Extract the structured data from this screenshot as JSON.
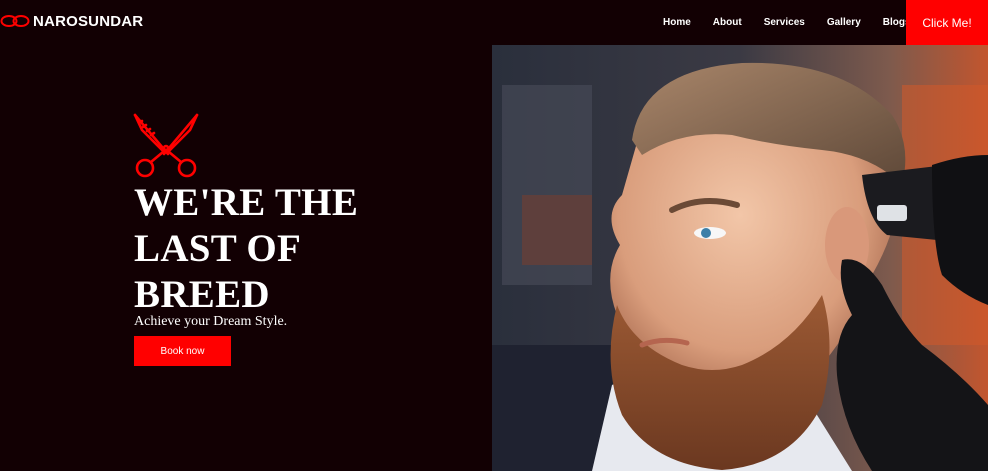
{
  "brand": {
    "name": "NAROSUNDAR",
    "icon": "chain-link-icon"
  },
  "nav": {
    "items": [
      {
        "label": "Home"
      },
      {
        "label": "About"
      },
      {
        "label": "Services"
      },
      {
        "label": "Gallery"
      },
      {
        "label": "Blogs"
      }
    ],
    "cta_label": "Click Me!"
  },
  "hero": {
    "icon": "scissors-icon",
    "title_lines": [
      "WE'RE THE",
      "LAST OF",
      "BREED"
    ],
    "subtitle": "Achieve your Dream Style.",
    "button_label": "Book now",
    "image": "barber-client-portrait"
  },
  "colors": {
    "background": "#120003",
    "accent": "#ff0000",
    "text": "#ffffff"
  }
}
